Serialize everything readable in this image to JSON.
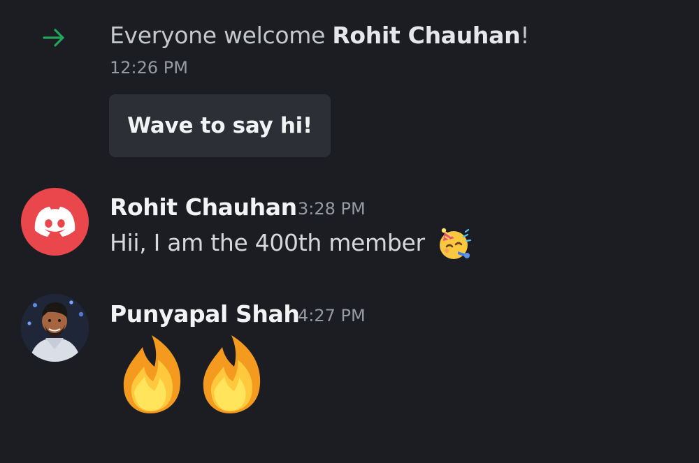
{
  "system_message": {
    "icon": "arrow-right-icon",
    "prefix": "Everyone welcome ",
    "mention": "Rohit Chauhan",
    "suffix": "!",
    "time": "12:26 PM",
    "button_label": "Wave to say hi!",
    "accent_color": "#23a55a"
  },
  "messages": [
    {
      "author": "Rohit Chauhan",
      "time": "3:28 PM",
      "avatar": "discord-logo-avatar",
      "avatar_color": "#e9474c",
      "text": "Hii, I am the 400th member",
      "emoji": "partying-face-emoji"
    },
    {
      "author": "Punyapal Shah",
      "time": "4:27 PM",
      "avatar": "user-photo-avatar",
      "emojis": [
        "fire-emoji",
        "fire-emoji"
      ]
    }
  ]
}
